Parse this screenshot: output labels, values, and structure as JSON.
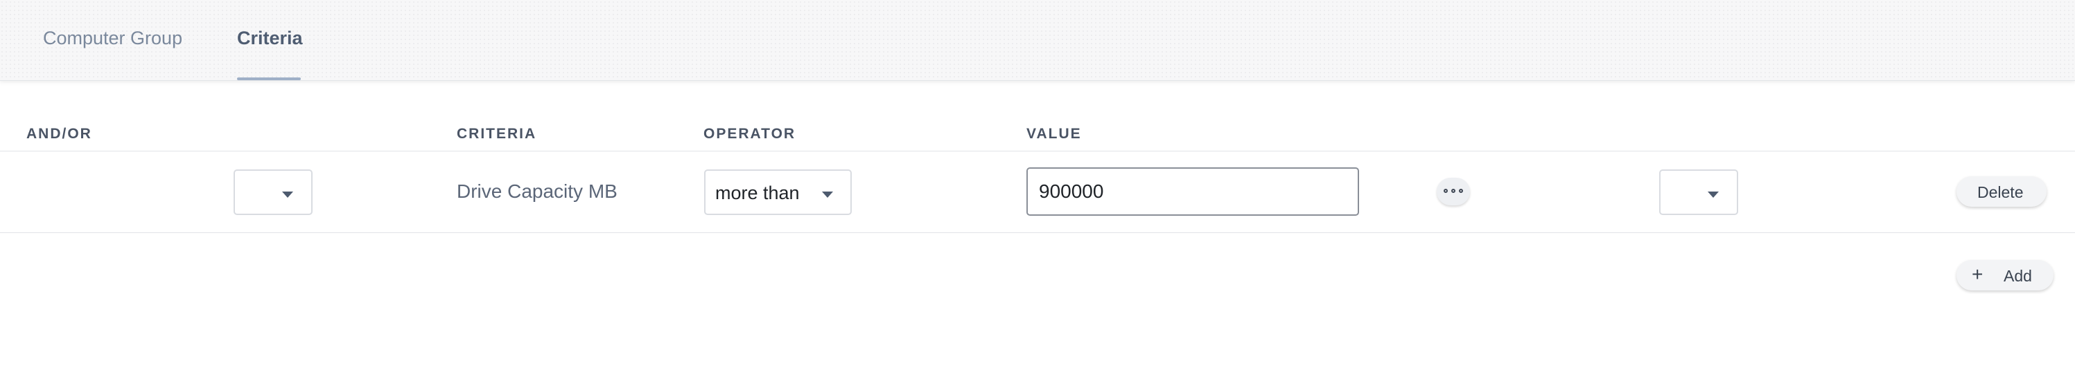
{
  "tabs": [
    {
      "label": "Computer Group",
      "active": false
    },
    {
      "label": "Criteria",
      "active": true
    }
  ],
  "table": {
    "headers": {
      "and_or": "AND/OR",
      "criteria": "CRITERIA",
      "operator": "OPERATOR",
      "value": "VALUE"
    },
    "rows": [
      {
        "and_or": "",
        "criteria": "Drive Capacity MB",
        "operator": "more than",
        "value": "900000",
        "paren": "",
        "delete_label": "Delete"
      }
    ]
  },
  "actions": {
    "add_label": "Add"
  },
  "icons": {
    "more": "more-options-icon",
    "add": "plus-icon",
    "caret": "chevron-down-icon"
  },
  "colors": {
    "active_tab_underline": "#9fb0c7",
    "tab_text": "#7a889c",
    "header_text": "#4a5465"
  }
}
